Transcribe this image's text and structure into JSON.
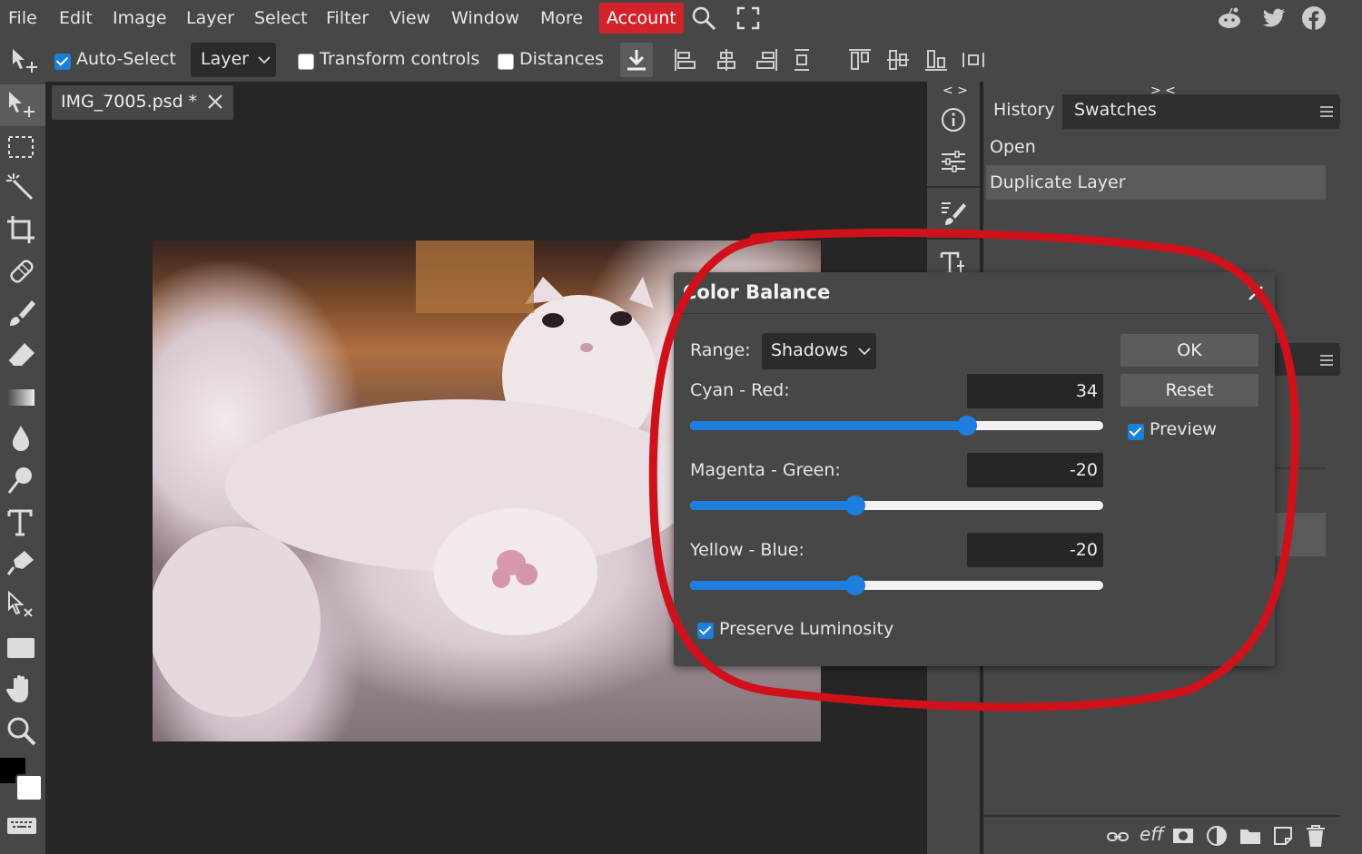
{
  "menubar": {
    "items": [
      "File",
      "Edit",
      "Image",
      "Layer",
      "Select",
      "Filter",
      "View",
      "Window",
      "More"
    ],
    "account_label": "Account",
    "accent_color": "#d3232a",
    "right_icons": [
      "search-icon",
      "fullscreen-icon",
      "reddit-icon",
      "twitter-icon",
      "facebook-icon"
    ]
  },
  "options": {
    "auto_select_label": "Auto-Select",
    "auto_select_checked": true,
    "layer_select_value": "Layer",
    "transform_controls_label": "Transform controls",
    "transform_controls_checked": false,
    "distances_label": "Distances",
    "distances_checked": false
  },
  "document": {
    "tab_label": "IMG_7005.psd *"
  },
  "panels": {
    "collapse_left": "< >",
    "collapse_right": "> <",
    "tabs": [
      "History",
      "Swatches"
    ],
    "history_items": [
      "Open",
      "Duplicate Layer"
    ]
  },
  "dialog": {
    "title": "Color Balance",
    "range_label": "Range:",
    "range_value": "Shadows",
    "cyan_red_label": "Cyan - Red:",
    "cyan_red_value": "34",
    "magenta_green_label": "Magenta - Green:",
    "magenta_green_value": "-20",
    "yellow_blue_label": "Yellow - Blue:",
    "yellow_blue_value": "-20",
    "slider_min": -100,
    "slider_max": 100,
    "preserve_luminosity_label": "Preserve Luminosity",
    "preserve_luminosity_checked": true,
    "ok_label": "OK",
    "reset_label": "Reset",
    "preview_label": "Preview",
    "preview_checked": true,
    "slider_color": "#1e7ee0"
  },
  "annotation": {
    "highlight_color": "#d0111c"
  }
}
